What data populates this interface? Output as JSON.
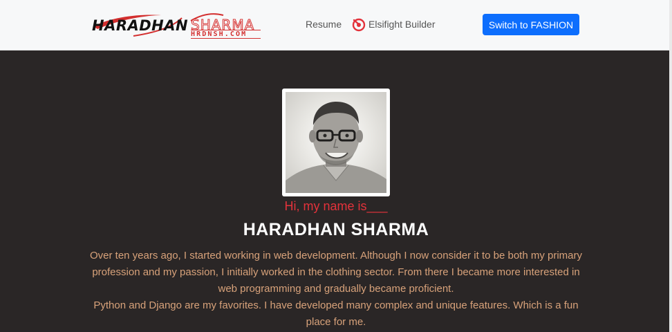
{
  "header": {
    "logo": {
      "first": "HARADHAN",
      "second": "SHARMA",
      "domain": "HRDNSH.COM"
    },
    "nav": {
      "resume": "Resume",
      "builder": "Elsifight Builder"
    },
    "switch_button": "Switch to FASHION",
    "colors": {
      "button": "#0d6efd",
      "logo_red": "#d32f2f"
    }
  },
  "hero": {
    "avatar_icon": "profile-photo",
    "greeting": "Hi, my name is___",
    "name": "HARADHAN SHARMA",
    "bio_paragraph_1": "Over ten years ago, I started working in web development. Although I now consider it to be both my primary profession and my passion, I initially worked in the clothing sector. From there I became more interested in web programming and gradually became proficient.",
    "bio_paragraph_2": "Python and Django are my favorites. I have developed many complex and unique features. Which is a fun place for me.",
    "colors": {
      "background": "#2a2626",
      "greeting": "#e3323b",
      "bio": "#d8a27a"
    }
  }
}
